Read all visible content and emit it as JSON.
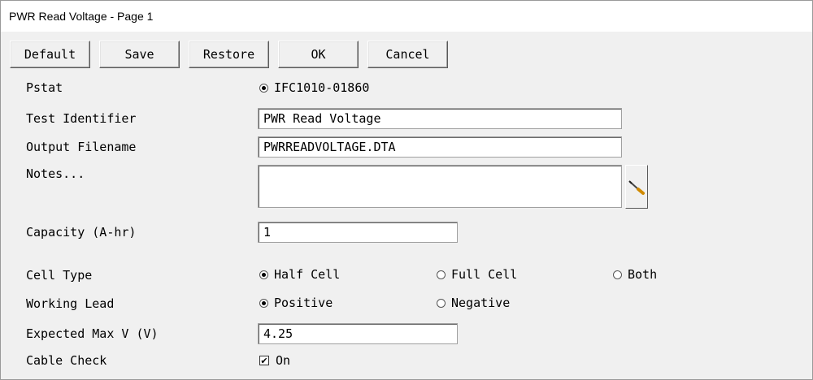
{
  "window": {
    "title": "PWR Read Voltage - Page 1"
  },
  "toolbar": {
    "default_label": "Default",
    "save_label": "Save",
    "restore_label": "Restore",
    "ok_label": "OK",
    "cancel_label": "Cancel"
  },
  "form": {
    "pstat": {
      "label": "Pstat",
      "option": "IFC1010-01860",
      "selected": true
    },
    "test_identifier": {
      "label": "Test Identifier",
      "value": "PWR Read Voltage"
    },
    "output_filename": {
      "label": "Output Filename",
      "value": "PWRREADVOLTAGE.DTA"
    },
    "notes": {
      "label": "Notes...",
      "value": "",
      "editor_icon": "screwdriver-icon"
    },
    "capacity": {
      "label": "Capacity (A-hr)",
      "value": "1"
    },
    "cell_type": {
      "label": "Cell Type",
      "options": [
        "Half Cell",
        "Full Cell",
        "Both"
      ],
      "selected": "Half Cell"
    },
    "working_lead": {
      "label": "Working Lead",
      "options": [
        "Positive",
        "Negative"
      ],
      "selected": "Positive"
    },
    "expected_max_v": {
      "label": "Expected Max V (V)",
      "value": "4.25"
    },
    "cable_check": {
      "label": "Cable Check",
      "option": "On",
      "checked": true,
      "check_glyph": "✔"
    }
  }
}
